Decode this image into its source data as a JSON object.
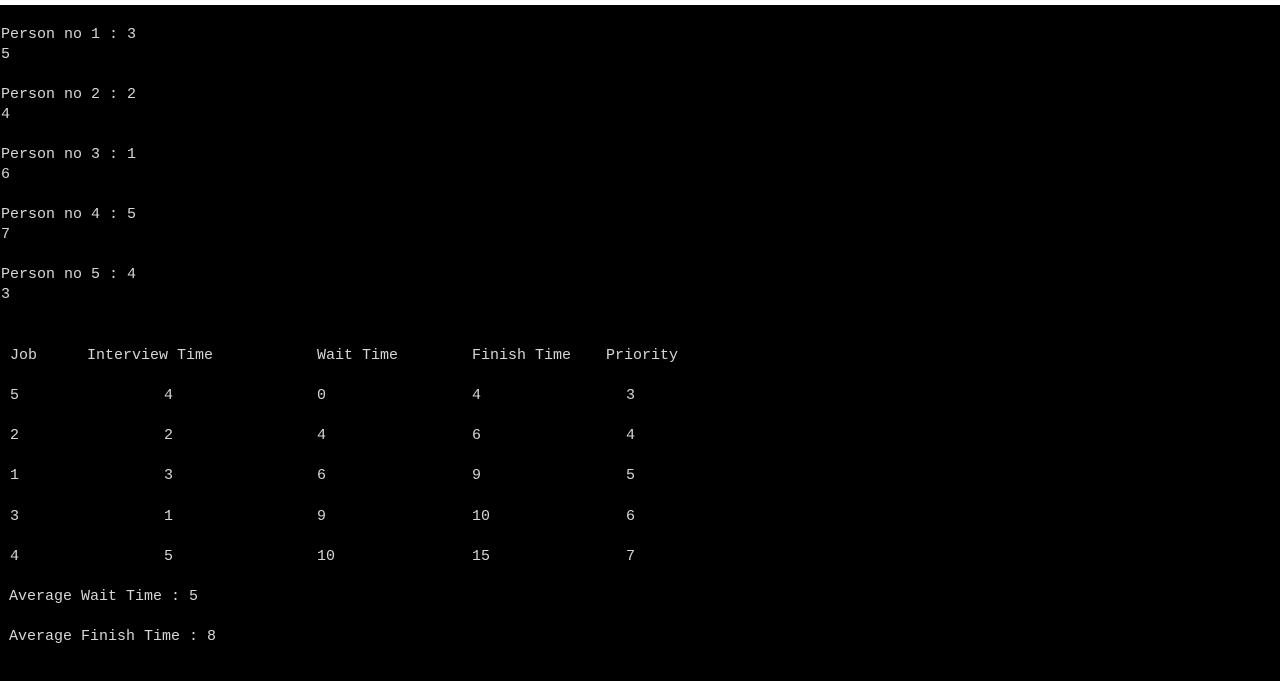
{
  "console": {
    "background": "#000000",
    "foreground": "#d6d6d6",
    "inputs": [
      {
        "prompt": "Person no 1 : 3",
        "value": "5"
      },
      {
        "prompt": "Person no 2 : 2",
        "value": "4"
      },
      {
        "prompt": "Person no 3 : 1",
        "value": "6"
      },
      {
        "prompt": "Person no 4 : 5",
        "value": "7"
      },
      {
        "prompt": "Person no 5 : 4",
        "value": "3"
      }
    ],
    "table": {
      "headers": [
        "Job",
        "Interview Time",
        "Wait Time",
        "Finish Time",
        "Priority"
      ],
      "rows": [
        [
          "5",
          "4",
          "0",
          "4",
          "3"
        ],
        [
          "2",
          "2",
          "4",
          "6",
          "4"
        ],
        [
          "1",
          "3",
          "6",
          "9",
          "5"
        ],
        [
          "3",
          "1",
          "9",
          "10",
          "6"
        ],
        [
          "4",
          "5",
          "10",
          "15",
          "7"
        ]
      ]
    },
    "summary": {
      "avg_wait": "Average Wait Time : 5",
      "avg_finish": "Average Finish Time : 8"
    }
  }
}
